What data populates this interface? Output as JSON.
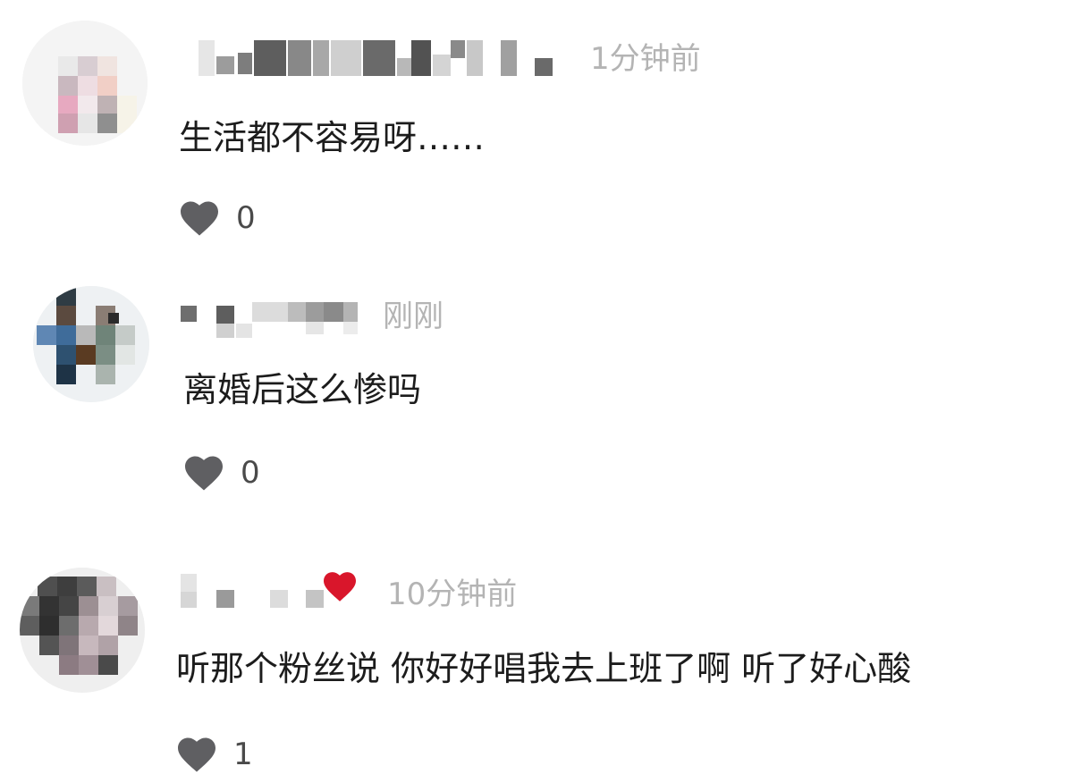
{
  "comments": [
    {
      "time": "1分钟前",
      "text": "生活都不容易呀……",
      "likes": "0",
      "avatar": "avatar-pixelated",
      "name": "username-pixelated"
    },
    {
      "time": "刚刚",
      "text": "离婚后这么惨吗",
      "likes": "0",
      "avatar": "avatar-pixelated",
      "name": "username-pixelated"
    },
    {
      "time": "10分钟前",
      "text": "听那个粉丝说 你好好唱我去上班了啊 听了好心酸",
      "likes": "1",
      "avatar": "avatar-pixelated",
      "name": "username-pixelated"
    }
  ],
  "colors": {
    "heart_icon": "#5f5f62",
    "name_emoji_heart": "#d9162b",
    "time_text": "#b4b4b4",
    "comment_text": "#1c1c1c"
  }
}
